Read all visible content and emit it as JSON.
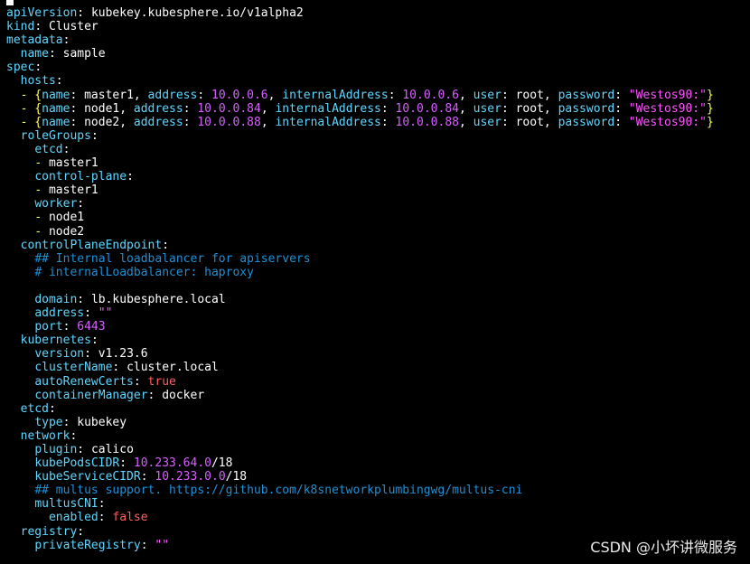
{
  "colors": {
    "background": "#000000",
    "key": "#5fd7ff",
    "text": "#ffffff",
    "string": "#ff55ff",
    "number": "#d75fff",
    "boolean": "#ff5f5f",
    "comment": "#1e90d6",
    "punct": "#ffff55"
  },
  "watermark": "CSDN @小坏讲微服务",
  "lines": [
    [
      [
        "apiVersion",
        "key"
      ],
      [
        ": ",
        "text"
      ],
      [
        "kubekey.kubesphere.io/v1alpha2",
        "text"
      ]
    ],
    [
      [
        "kind",
        "key"
      ],
      [
        ": ",
        "text"
      ],
      [
        "Cluster",
        "text"
      ]
    ],
    [
      [
        "metadata",
        "key"
      ],
      [
        ":",
        "text"
      ]
    ],
    [
      [
        "  ",
        "text"
      ],
      [
        "name",
        "key"
      ],
      [
        ": ",
        "text"
      ],
      [
        "sample",
        "text"
      ]
    ],
    [
      [
        "spec",
        "key"
      ],
      [
        ":",
        "text"
      ]
    ],
    [
      [
        "  ",
        "text"
      ],
      [
        "hosts",
        "key"
      ],
      [
        ":",
        "text"
      ]
    ],
    [
      [
        "  ",
        "text"
      ],
      [
        "- {",
        "punct"
      ],
      [
        "name",
        "key"
      ],
      [
        ": master1, ",
        "text"
      ],
      [
        "address",
        "key"
      ],
      [
        ": ",
        "text"
      ],
      [
        "10.0.0.6",
        "number"
      ],
      [
        ", ",
        "text"
      ],
      [
        "internalAddress",
        "key"
      ],
      [
        ": ",
        "text"
      ],
      [
        "10.0.0.6",
        "number"
      ],
      [
        ", ",
        "text"
      ],
      [
        "user",
        "key"
      ],
      [
        ": root, ",
        "text"
      ],
      [
        "password",
        "key"
      ],
      [
        ": ",
        "text"
      ],
      [
        "\"Westos90:\"",
        "string"
      ],
      [
        "}",
        "punct"
      ]
    ],
    [
      [
        "  ",
        "text"
      ],
      [
        "- {",
        "punct"
      ],
      [
        "name",
        "key"
      ],
      [
        ": node1, ",
        "text"
      ],
      [
        "address",
        "key"
      ],
      [
        ": ",
        "text"
      ],
      [
        "10.0.0.84",
        "number"
      ],
      [
        ", ",
        "text"
      ],
      [
        "internalAddress",
        "key"
      ],
      [
        ": ",
        "text"
      ],
      [
        "10.0.0.84",
        "number"
      ],
      [
        ", ",
        "text"
      ],
      [
        "user",
        "key"
      ],
      [
        ": root, ",
        "text"
      ],
      [
        "password",
        "key"
      ],
      [
        ": ",
        "text"
      ],
      [
        "\"Westos90:\"",
        "string"
      ],
      [
        "}",
        "punct"
      ]
    ],
    [
      [
        "  ",
        "text"
      ],
      [
        "- {",
        "punct"
      ],
      [
        "name",
        "key"
      ],
      [
        ": node2, ",
        "text"
      ],
      [
        "address",
        "key"
      ],
      [
        ": ",
        "text"
      ],
      [
        "10.0.0.88",
        "number"
      ],
      [
        ", ",
        "text"
      ],
      [
        "internalAddress",
        "key"
      ],
      [
        ": ",
        "text"
      ],
      [
        "10.0.0.88",
        "number"
      ],
      [
        ", ",
        "text"
      ],
      [
        "user",
        "key"
      ],
      [
        ": root, ",
        "text"
      ],
      [
        "password",
        "key"
      ],
      [
        ": ",
        "text"
      ],
      [
        "\"Westos90:\"",
        "string"
      ],
      [
        "}",
        "punct"
      ]
    ],
    [
      [
        "  ",
        "text"
      ],
      [
        "roleGroups",
        "key"
      ],
      [
        ":",
        "text"
      ]
    ],
    [
      [
        "    ",
        "text"
      ],
      [
        "etcd",
        "key"
      ],
      [
        ":",
        "text"
      ]
    ],
    [
      [
        "    ",
        "text"
      ],
      [
        "- ",
        "punct"
      ],
      [
        "master1",
        "text"
      ]
    ],
    [
      [
        "    ",
        "text"
      ],
      [
        "control-plane",
        "key"
      ],
      [
        ":",
        "text"
      ]
    ],
    [
      [
        "    ",
        "text"
      ],
      [
        "- ",
        "punct"
      ],
      [
        "master1",
        "text"
      ]
    ],
    [
      [
        "    ",
        "text"
      ],
      [
        "worker",
        "key"
      ],
      [
        ":",
        "text"
      ]
    ],
    [
      [
        "    ",
        "text"
      ],
      [
        "- ",
        "punct"
      ],
      [
        "node1",
        "text"
      ]
    ],
    [
      [
        "    ",
        "text"
      ],
      [
        "- ",
        "punct"
      ],
      [
        "node2",
        "text"
      ]
    ],
    [
      [
        "  ",
        "text"
      ],
      [
        "controlPlaneEndpoint",
        "key"
      ],
      [
        ":",
        "text"
      ]
    ],
    [
      [
        "    ",
        "text"
      ],
      [
        "## Internal loadbalancer for apiservers",
        "comment"
      ]
    ],
    [
      [
        "    ",
        "text"
      ],
      [
        "# internalLoadbalancer: haproxy",
        "comment"
      ]
    ],
    [
      [
        "",
        "text"
      ]
    ],
    [
      [
        "    ",
        "text"
      ],
      [
        "domain",
        "key"
      ],
      [
        ": ",
        "text"
      ],
      [
        "lb.kubesphere.local",
        "text"
      ]
    ],
    [
      [
        "    ",
        "text"
      ],
      [
        "address",
        "key"
      ],
      [
        ": ",
        "text"
      ],
      [
        "\"\"",
        "string"
      ]
    ],
    [
      [
        "    ",
        "text"
      ],
      [
        "port",
        "key"
      ],
      [
        ": ",
        "text"
      ],
      [
        "6443",
        "number"
      ]
    ],
    [
      [
        "  ",
        "text"
      ],
      [
        "kubernetes",
        "key"
      ],
      [
        ":",
        "text"
      ]
    ],
    [
      [
        "    ",
        "text"
      ],
      [
        "version",
        "key"
      ],
      [
        ": ",
        "text"
      ],
      [
        "v1.23.6",
        "text"
      ]
    ],
    [
      [
        "    ",
        "text"
      ],
      [
        "clusterName",
        "key"
      ],
      [
        ": ",
        "text"
      ],
      [
        "cluster.local",
        "text"
      ]
    ],
    [
      [
        "    ",
        "text"
      ],
      [
        "autoRenewCerts",
        "key"
      ],
      [
        ": ",
        "text"
      ],
      [
        "true",
        "boolean"
      ]
    ],
    [
      [
        "    ",
        "text"
      ],
      [
        "containerManager",
        "key"
      ],
      [
        ": ",
        "text"
      ],
      [
        "docker",
        "text"
      ]
    ],
    [
      [
        "  ",
        "text"
      ],
      [
        "etcd",
        "key"
      ],
      [
        ":",
        "text"
      ]
    ],
    [
      [
        "    ",
        "text"
      ],
      [
        "type",
        "key"
      ],
      [
        ": ",
        "text"
      ],
      [
        "kubekey",
        "text"
      ]
    ],
    [
      [
        "  ",
        "text"
      ],
      [
        "network",
        "key"
      ],
      [
        ":",
        "text"
      ]
    ],
    [
      [
        "    ",
        "text"
      ],
      [
        "plugin",
        "key"
      ],
      [
        ": ",
        "text"
      ],
      [
        "calico",
        "text"
      ]
    ],
    [
      [
        "    ",
        "text"
      ],
      [
        "kubePodsCIDR",
        "key"
      ],
      [
        ": ",
        "text"
      ],
      [
        "10.233.64.0",
        "number"
      ],
      [
        "/18",
        "text"
      ]
    ],
    [
      [
        "    ",
        "text"
      ],
      [
        "kubeServiceCIDR",
        "key"
      ],
      [
        ": ",
        "text"
      ],
      [
        "10.233.0.0",
        "number"
      ],
      [
        "/18",
        "text"
      ]
    ],
    [
      [
        "    ",
        "text"
      ],
      [
        "## multus support. https://github.com/k8snetworkplumbingwg/multus-cni",
        "comment"
      ]
    ],
    [
      [
        "    ",
        "text"
      ],
      [
        "multusCNI",
        "key"
      ],
      [
        ":",
        "text"
      ]
    ],
    [
      [
        "      ",
        "text"
      ],
      [
        "enabled",
        "key"
      ],
      [
        ": ",
        "text"
      ],
      [
        "false",
        "boolean"
      ]
    ],
    [
      [
        "  ",
        "text"
      ],
      [
        "registry",
        "key"
      ],
      [
        ":",
        "text"
      ]
    ],
    [
      [
        "    ",
        "text"
      ],
      [
        "privateRegistry",
        "key"
      ],
      [
        ": ",
        "text"
      ],
      [
        "\"\"",
        "string"
      ]
    ]
  ]
}
